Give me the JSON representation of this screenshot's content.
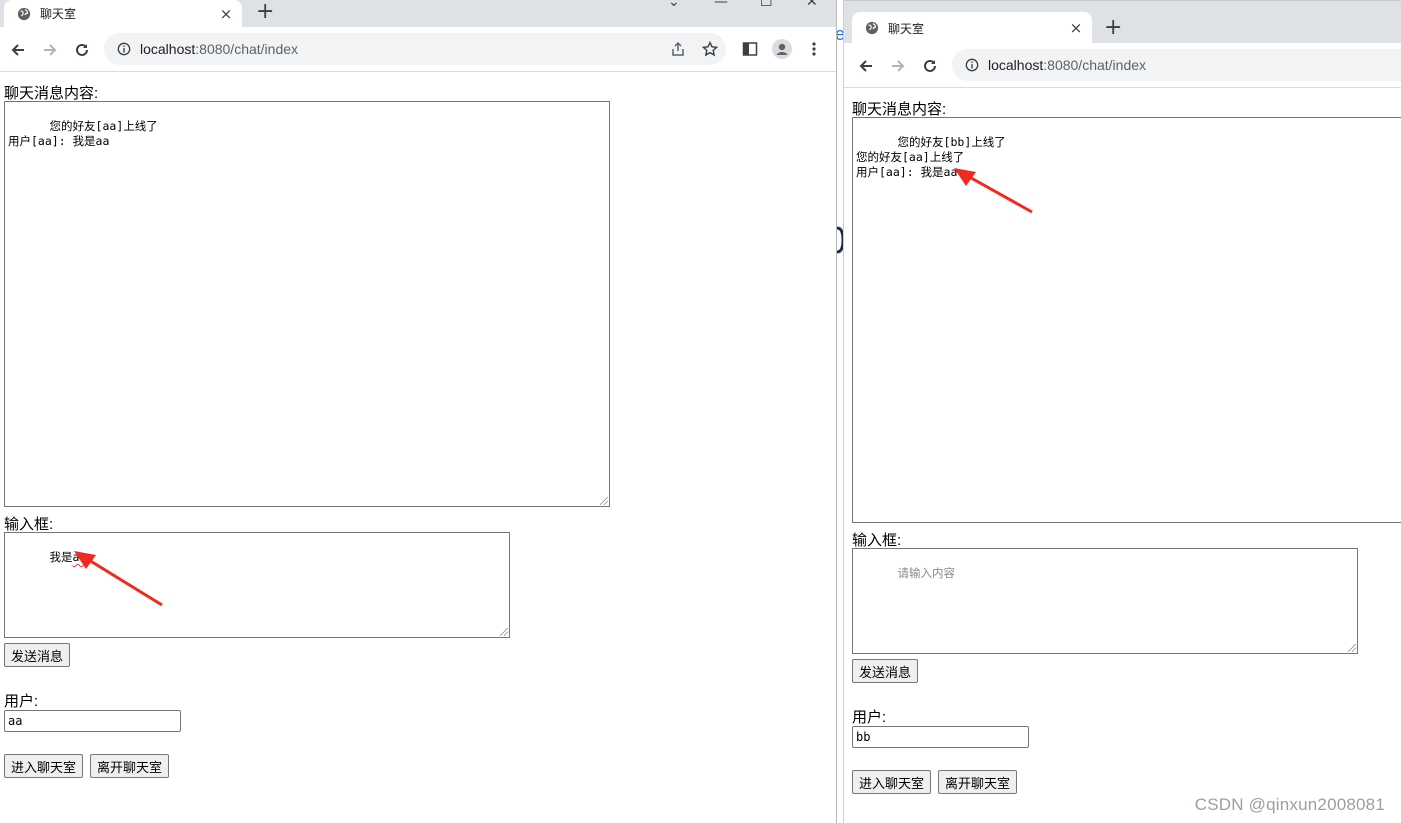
{
  "left": {
    "tab": {
      "title": "聊天室",
      "close": "×"
    },
    "newtab": "+",
    "window_controls": {
      "minimize": "—",
      "maximize": "☐",
      "close": "✕"
    },
    "url": {
      "host": "localhost",
      "path": ":8080/chat/index"
    },
    "chat_label": "聊天消息内容:",
    "chat_log": "您的好友[aa]上线了\n用户[aa]: 我是aa",
    "input_label": "输入框:",
    "input_value_prefix": "我是",
    "input_value_squiggle": "aa",
    "send_button": "发送消息",
    "user_label": "用户:",
    "user_value": "aa",
    "enter_button": "进入聊天室",
    "leave_button": "离开聊天室"
  },
  "right": {
    "tab": {
      "title": "聊天室",
      "close": "×"
    },
    "newtab": "+",
    "url": {
      "host": "localhost",
      "path": ":8080/chat/index"
    },
    "chat_label": "聊天消息内容:",
    "chat_log": "您的好友[bb]上线了\n您的好友[aa]上线了\n用户[aa]: 我是aa",
    "input_label": "输入框:",
    "input_placeholder": "请输入内容",
    "send_button": "发送消息",
    "user_label": "用户:",
    "user_value": "bb",
    "enter_button": "进入聊天室",
    "leave_button": "离开聊天室"
  },
  "watermark": "CSDN @qinxun2008081",
  "colors": {
    "annotation_arrow": "#f02a1e",
    "tabstrip": "#dee1e6",
    "omnibox": "#f1f3f4"
  },
  "icons": [
    "globe-icon",
    "back-icon",
    "forward-icon",
    "reload-icon",
    "info-icon",
    "share-icon",
    "star-icon",
    "sidepanel-icon",
    "profile-icon",
    "menu-icon"
  ]
}
